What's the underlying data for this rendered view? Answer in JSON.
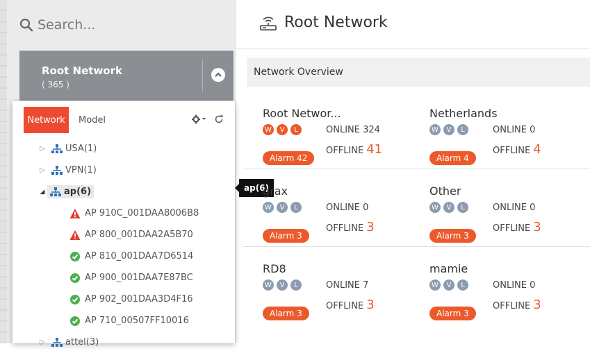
{
  "search": {
    "placeholder": "Search..."
  },
  "root_card": {
    "title": "Root Network",
    "count": "( 365 )"
  },
  "tabs": {
    "network": "Network",
    "model": "Model"
  },
  "tree": {
    "nodes": [
      {
        "label": "USA(1)",
        "caret": "▷"
      },
      {
        "label": "VPN(1)",
        "caret": "▷"
      },
      {
        "label": "ap(6)",
        "caret": "◢"
      }
    ],
    "aps": [
      {
        "label": "AP 910C_001DAA8006B8",
        "status": "alarm"
      },
      {
        "label": "AP 800_001DAA2A5B70",
        "status": "alarm"
      },
      {
        "label": "AP 810_001DAA7D6514",
        "status": "ok"
      },
      {
        "label": "AP 900_001DAA7E87BC",
        "status": "ok"
      },
      {
        "label": "AP 902_001DAA3D4F16",
        "status": "ok"
      },
      {
        "label": "AP 710_00507FF10016",
        "status": "ok"
      }
    ],
    "last": {
      "label": "attel(3)",
      "caret": "▷"
    }
  },
  "tooltip": "ap(6)",
  "header": {
    "title": "Root Network"
  },
  "overview": {
    "title": "Network Overview"
  },
  "badge_letters": [
    "W",
    "V",
    "L"
  ],
  "networks": [
    {
      "name": "Root Networ...",
      "online_label": "ONLINE",
      "online": "324",
      "offline_label": "OFFLINE",
      "offline": "41",
      "alarm": "Alarm 42",
      "active": true
    },
    {
      "name": "Netherlands",
      "online_label": "ONLINE",
      "online": "0",
      "offline_label": "OFFLINE",
      "offline": "4",
      "alarm": "Alarm 4",
      "active": false
    },
    {
      "name": "grax",
      "online_label": "ONLINE",
      "online": "0",
      "offline_label": "OFFLINE",
      "offline": "3",
      "alarm": "Alarm 3",
      "active": false
    },
    {
      "name": "Other",
      "online_label": "ONLINE",
      "online": "0",
      "offline_label": "OFFLINE",
      "offline": "3",
      "alarm": "Alarm 3",
      "active": false
    },
    {
      "name": "RD8",
      "online_label": "ONLINE",
      "online": "7",
      "offline_label": "OFFLINE",
      "offline": "3",
      "alarm": "Alarm 3",
      "active": false
    },
    {
      "name": "mamie",
      "online_label": "ONLINE",
      "online": "0",
      "offline_label": "OFFLINE",
      "offline": "3",
      "alarm": "Alarm 3",
      "active": false
    }
  ],
  "colors": {
    "accent": "#ec4b32",
    "badge_active": "#ec5a2c",
    "badge_inactive": "#8b9cb0",
    "alarm_icon": "#e53935",
    "ok_icon": "#4caf50"
  }
}
